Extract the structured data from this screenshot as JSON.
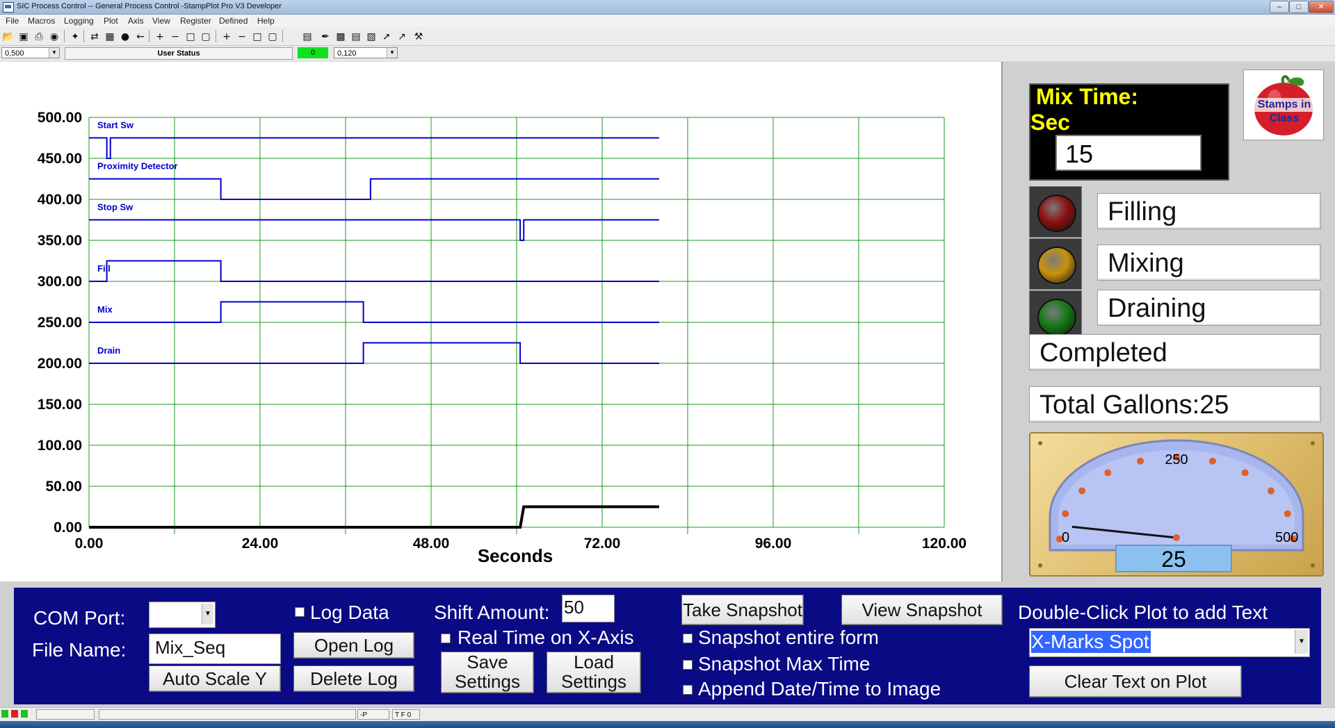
{
  "window": {
    "title": "SIC Process Control -- General Process Control -StampPlot Pro V3 Developer"
  },
  "menu": [
    "File",
    "Macros",
    "Logging",
    "Plot",
    "Axis",
    "View",
    "Register",
    "Defined",
    "Help"
  ],
  "status_row": {
    "left_combo": "0,500",
    "user_status": "User Status",
    "indicator_value": "0",
    "right_combo": "0,120"
  },
  "chart_data": {
    "type": "line",
    "xlabel": "Seconds",
    "xlim": [
      0,
      120
    ],
    "ylim": [
      0,
      500
    ],
    "x_ticks": [
      "0.00",
      "24.00",
      "48.00",
      "72.00",
      "96.00",
      "120.00"
    ],
    "y_ticks": [
      "0.00",
      "50.00",
      "100.00",
      "150.00",
      "200.00",
      "250.00",
      "300.00",
      "350.00",
      "400.00",
      "450.00",
      "500.00"
    ],
    "grid": true,
    "series": [
      {
        "name": "Start Sw",
        "color": "#0000cc",
        "x": [
          0,
          2.5,
          2.5,
          3,
          3,
          80
        ],
        "y": [
          475,
          475,
          450,
          450,
          475,
          475
        ]
      },
      {
        "name": "Proximity Detector",
        "color": "#0000cc",
        "x": [
          0,
          18.5,
          18.5,
          39.5,
          39.5,
          80
        ],
        "y": [
          425,
          425,
          400,
          400,
          425,
          425
        ]
      },
      {
        "name": "Stop Sw",
        "color": "#0000cc",
        "x": [
          0,
          60.5,
          60.5,
          61,
          61,
          80
        ],
        "y": [
          375,
          375,
          350,
          350,
          375,
          375
        ]
      },
      {
        "name": "Fill",
        "color": "#0000cc",
        "x": [
          0,
          2.5,
          2.5,
          18.5,
          18.5,
          80
        ],
        "y": [
          300,
          300,
          325,
          325,
          300,
          300
        ]
      },
      {
        "name": "Mix",
        "color": "#0000cc",
        "x": [
          0,
          18.5,
          18.5,
          38.5,
          38.5,
          80
        ],
        "y": [
          250,
          250,
          275,
          275,
          250,
          250
        ]
      },
      {
        "name": "Drain",
        "color": "#0000cc",
        "x": [
          0,
          38.5,
          38.5,
          60.5,
          60.5,
          80
        ],
        "y": [
          200,
          200,
          225,
          225,
          200,
          200
        ]
      },
      {
        "color": "#000000",
        "x": [
          0,
          60.5,
          61,
          80
        ],
        "y": [
          0,
          0,
          25,
          25
        ]
      }
    ]
  },
  "right_panel": {
    "mix_time_title": "Mix Time:",
    "mix_time_unit": "Sec",
    "mix_time_value": "15",
    "logo_text": "Stamps in Class",
    "lamps": [
      {
        "label": "Filling",
        "color": "#8b1010"
      },
      {
        "label": "Mixing",
        "color": "#c8920a"
      },
      {
        "label": "Draining",
        "color": "#137a14"
      }
    ],
    "completed_label": "Completed",
    "total_gallons": "Total Gallons:25",
    "gauge": {
      "min_label": "0",
      "mid_label": "250",
      "max_label": "500",
      "min": 0,
      "max": 500,
      "value": 25,
      "readout": "25"
    }
  },
  "bottom": {
    "com_port_label": "COM Port:",
    "com_port_value": "",
    "file_name_label": "File Name:",
    "file_name_value": "Mix_Seq",
    "auto_scale_label": "Auto Scale Y",
    "log_data_label": "Log Data",
    "open_log_label": "Open Log",
    "delete_log_label": "Delete Log",
    "shift_amount_label": "Shift Amount:",
    "shift_amount_value": "50",
    "real_time_label": "Real Time on X-Axis",
    "save_settings_line1": "Save",
    "save_settings_line2": "Settings",
    "load_settings_line1": "Load",
    "load_settings_line2": "Settings",
    "take_snapshot_label": "Take Snapshot",
    "view_snapshot_label": "View Snapshot",
    "snapshot_form_label": "Snapshot entire form",
    "snapshot_max_label": "Snapshot Max Time",
    "append_date_label": "Append Date/Time to Image",
    "dbl_click_label": "Double-Click Plot to add Text",
    "text_select_value": "X-Marks Spot",
    "clear_text_label": "Clear Text on Plot"
  },
  "statusbar": {
    "cell_p": "-P",
    "cell_tf": "T F 0"
  }
}
